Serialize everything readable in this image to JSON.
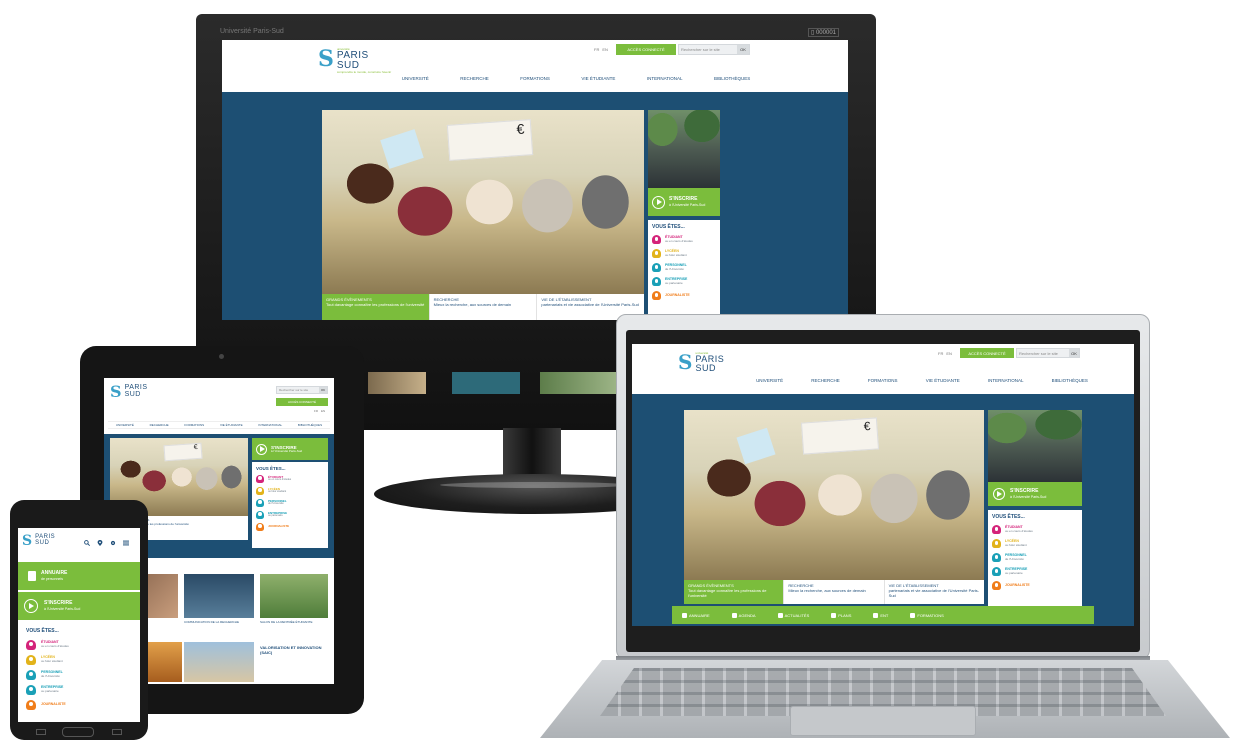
{
  "site": {
    "logo": {
      "kicker": "université",
      "main": "PARIS",
      "sub": "SUD",
      "tagline": "comprendre le monde, construire l'avenir"
    },
    "lang": [
      "FR",
      "EN"
    ],
    "access_button": "ACCÈS CONNECTÉ",
    "search_placeholder": "Rechercher sur le site",
    "search_ok": "OK",
    "nav": [
      "UNIVERSITÉ",
      "RECHERCHE",
      "FORMATIONS",
      "VIE ÉTUDIANTE",
      "INTERNATIONAL",
      "BIBLIOTHÈQUES"
    ],
    "hero": {
      "sign_text": "€"
    },
    "news": [
      {
        "title": "GRANDS ÉVÈNEMENTS",
        "text": "Tout davantage connaître les professions de l'université"
      },
      {
        "title": "RECHERCHE",
        "text": "Mieux la recherche, aux sources de demain"
      },
      {
        "title": "VIE DE L'ÉTABLISSEMENT",
        "text": "partenariats et vie associative de l'Université Paris-Sud"
      }
    ],
    "inscrire": {
      "title": "S'INSCRIRE",
      "sub": "à l'Université Paris-Sud"
    },
    "vous_etes": {
      "title": "VOUS ÊTES...",
      "items": [
        {
          "title": "ÉTUDIANT",
          "sub": "ou en cours d'études",
          "color": "#d4237a"
        },
        {
          "title": "LYCÉEN",
          "sub": "ou futur étudiant",
          "color": "#e2b31a"
        },
        {
          "title": "PERSONNEL",
          "sub": "de l'Université",
          "color": "#1aa0b7"
        },
        {
          "title": "ENTREPRISE",
          "sub": "ou partenaire",
          "color": "#1aa0b7"
        },
        {
          "title": "JOURNALISTE",
          "sub": "ou média",
          "color": "#f07d1a"
        }
      ]
    },
    "bottom_bar": [
      "ANNUAIRE",
      "AGENDA",
      "ACTUALITÉS",
      "PLANS",
      "ENT",
      "FORMATIONS"
    ],
    "tablet_cards": [
      {
        "text": "COMMUNICATION DE LA RECHERCHE"
      },
      {
        "text": "SALON DE LA RENTRÉE ÉTUDIANTE"
      },
      {
        "text": "VALORISATION ET INNOVATION (SAIC)"
      }
    ],
    "phone": {
      "annuaire_title": "ANNUAIRE",
      "annuaire_sub": "de personnels"
    }
  },
  "monitor": {
    "window_title": "Université Paris-Sud",
    "badge": "▯ 000001"
  },
  "colors": {
    "brand_green": "#7bbd3c",
    "brand_blue": "#1f4e79",
    "band_blue": "#1d4f73"
  }
}
